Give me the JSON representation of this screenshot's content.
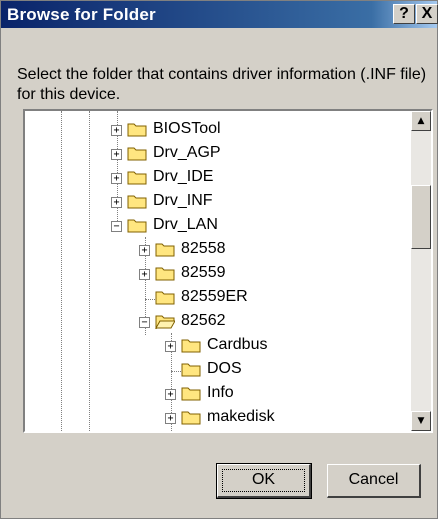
{
  "window": {
    "title": "Browse for Folder",
    "help_label": "?",
    "close_label": "X"
  },
  "description": "Select the folder that contains driver information (.INF file) for this device.",
  "tree": {
    "items": [
      {
        "label": "BIOSTool",
        "expander": "+"
      },
      {
        "label": "Drv_AGP",
        "expander": "+"
      },
      {
        "label": "Drv_IDE",
        "expander": "+"
      },
      {
        "label": "Drv_INF",
        "expander": "+"
      },
      {
        "label": "Drv_LAN",
        "expander": "−"
      },
      {
        "label": "82558",
        "expander": "+"
      },
      {
        "label": "82559",
        "expander": "+"
      },
      {
        "label": "82559ER",
        "expander": ""
      },
      {
        "label": "82562",
        "expander": "−"
      },
      {
        "label": "Cardbus",
        "expander": "+"
      },
      {
        "label": "DOS",
        "expander": ""
      },
      {
        "label": "Info",
        "expander": "+"
      },
      {
        "label": "makedisk",
        "expander": "+"
      }
    ]
  },
  "scrollbar": {
    "up_icon": "▲",
    "down_icon": "▼"
  },
  "buttons": {
    "ok": "OK",
    "cancel": "Cancel"
  },
  "colors": {
    "title_start": "#0a246a",
    "title_end": "#a6caf0",
    "folder": "#ffe680",
    "dialog": "#d4d0c8"
  }
}
